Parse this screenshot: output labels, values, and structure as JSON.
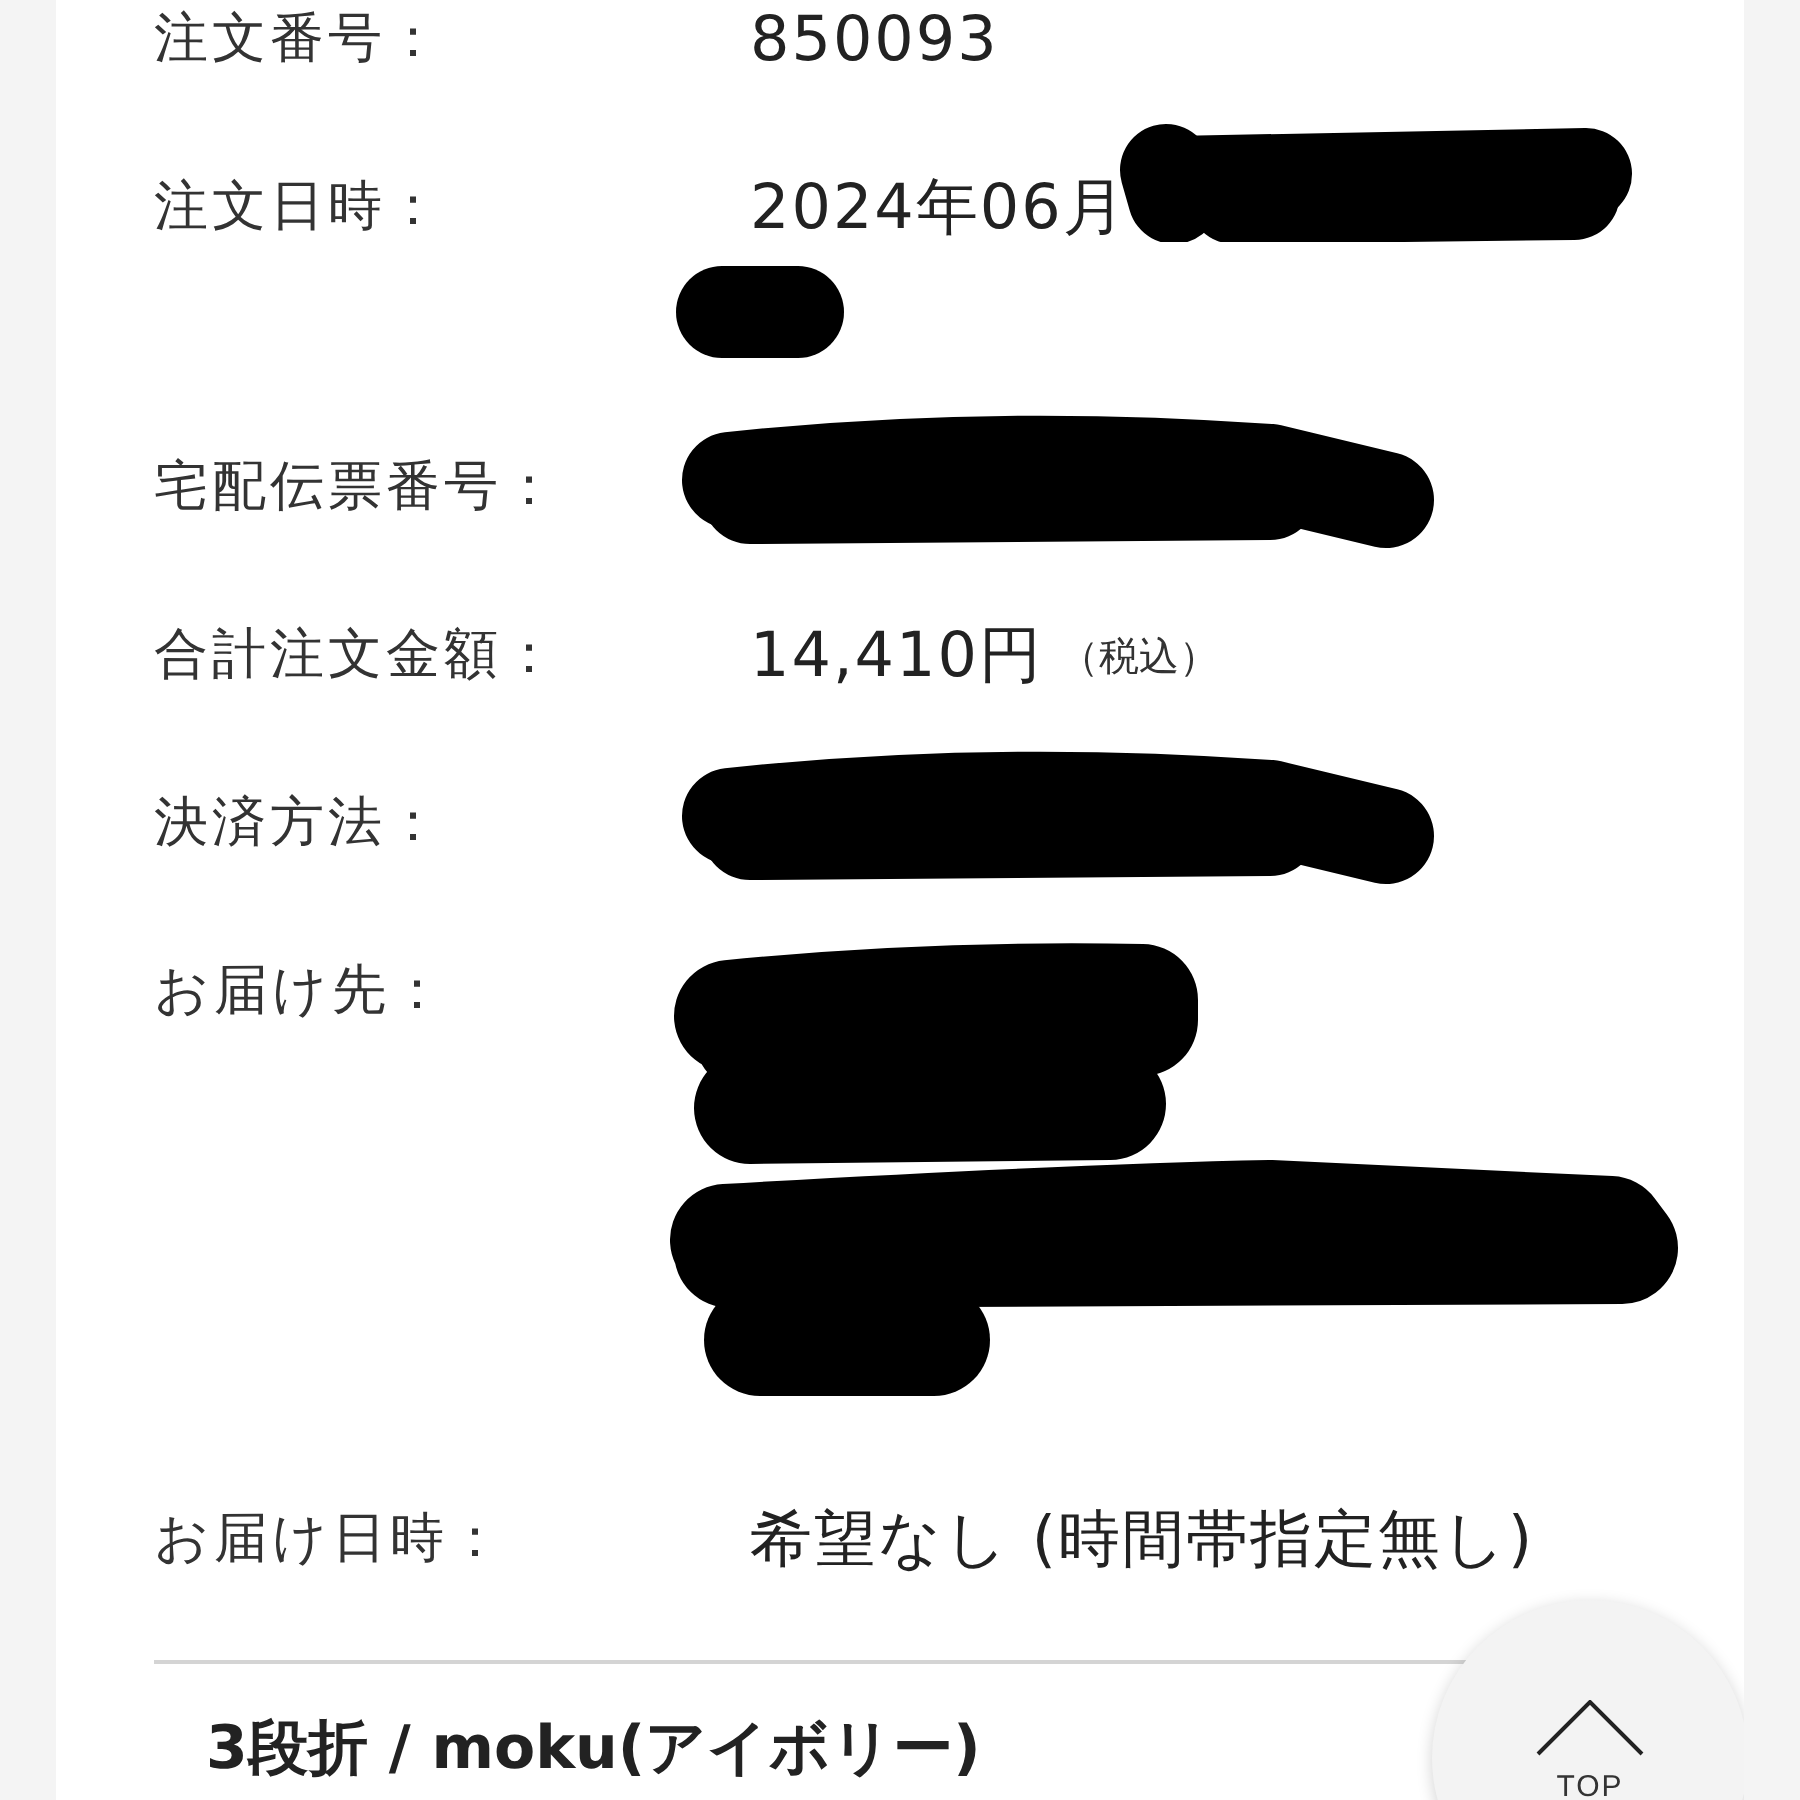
{
  "order_details": [
    {
      "label": "注文番号：",
      "kind": "text",
      "value": "850093"
    },
    {
      "label": "注文日時：",
      "kind": "partly_redacted",
      "value": "2024年06月"
    },
    {
      "label": "宅配伝票番号：",
      "kind": "redacted_line"
    },
    {
      "label": "合計注文金額：",
      "kind": "text",
      "value": "14,410円",
      "note": "（税込）"
    },
    {
      "label": "決済方法：",
      "kind": "redacted_line"
    },
    {
      "label": "お届け先：",
      "kind": "redacted_block"
    },
    {
      "label": "お届け日時：",
      "kind": "text",
      "value": "希望なし (時間帯指定無し)"
    }
  ],
  "product": {
    "title": "3段折 / moku(アイボリー)"
  },
  "top_button": {
    "label": "TOP"
  }
}
